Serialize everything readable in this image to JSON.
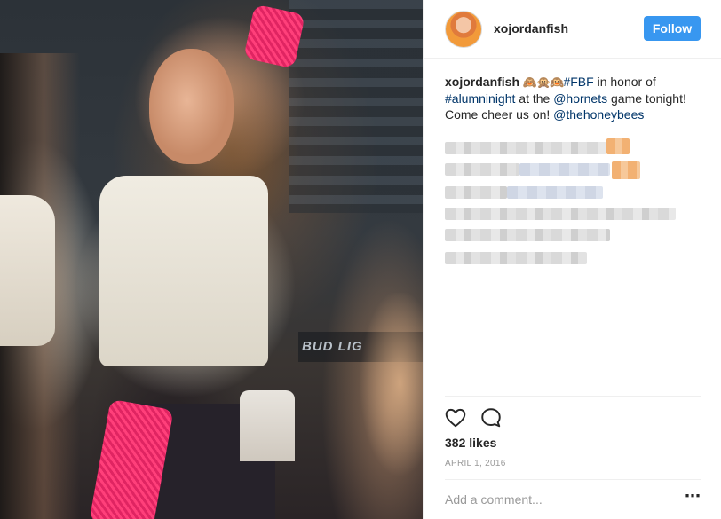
{
  "post": {
    "image_alt": "Post photo"
  },
  "header": {
    "avatar_icon": "profile-avatar",
    "username": "xojordanfish",
    "follow_label": "Follow",
    "follow_color": "#3897f0"
  },
  "caption": {
    "username": "xojordanfish",
    "emoji": "🙈🙊🙉",
    "tag_fbf": "#FBF",
    "text1": " in honor of ",
    "tag_alumni": "#alumninight",
    "text2": " at the ",
    "mention_hornets": "@hornets",
    "text3": " game tonight! Come cheer us on! ",
    "mention_honeybees": "@thehoneybees",
    "link_color": "#003569"
  },
  "actions": {
    "like_icon": "heart-icon",
    "comment_icon": "comment-icon",
    "likes": "382 likes",
    "date": "APRIL 1, 2016"
  },
  "comment": {
    "placeholder": "Add a comment...",
    "more_icon": "more-options-icon"
  }
}
